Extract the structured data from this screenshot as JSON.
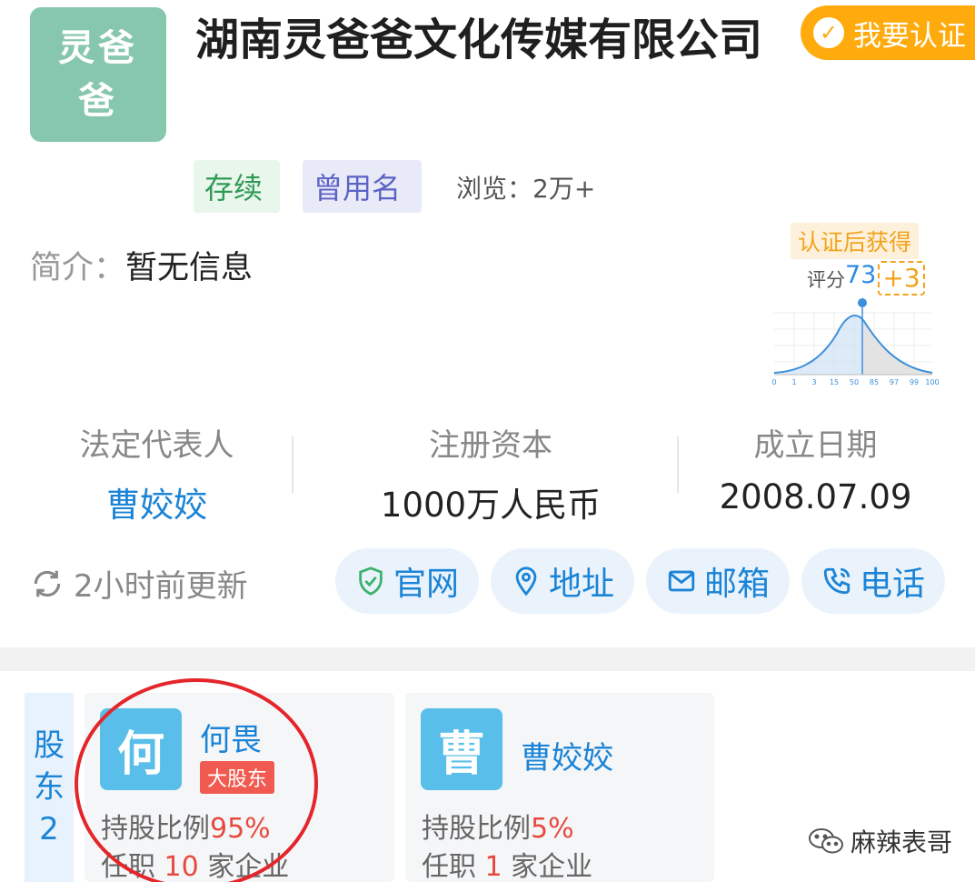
{
  "company": {
    "logo_text_line1": "灵爸",
    "logo_text_line2": "爸",
    "name": "湖南灵爸爸文化传媒有限公司",
    "certify_label": "我要认证",
    "status_tag": "存续",
    "old_name_tag": "曾用名",
    "views": "浏览：2万+",
    "intro_label": "简介：",
    "intro_value": "暂无信息"
  },
  "score": {
    "tip": "认证后获得",
    "label": "评分",
    "value": "73",
    "bonus": "+3",
    "axis_ticks": [
      "0",
      "1",
      "3",
      "15",
      "50",
      "85",
      "97",
      "99",
      "100"
    ]
  },
  "stats": [
    {
      "label": "法定代表人",
      "value": "曹姣姣"
    },
    {
      "label": "注册资本",
      "value": "1000万人民币"
    },
    {
      "label": "成立日期",
      "value": "2008.07.09"
    }
  ],
  "updated": "2小时前更新",
  "actions": [
    {
      "label": "官网",
      "icon": "shield-check-icon"
    },
    {
      "label": "地址",
      "icon": "location-pin-icon"
    },
    {
      "label": "邮箱",
      "icon": "mail-icon"
    },
    {
      "label": "电话",
      "icon": "phone-icon"
    }
  ],
  "shareholders": {
    "tab_line1": "股",
    "tab_line2": "东",
    "tab_count": "2",
    "items": [
      {
        "avatar": "何",
        "name": "何畏",
        "badge": "大股东",
        "ratio_label": "持股比例",
        "ratio": "95%",
        "jobs_prefix": "任职 ",
        "jobs_count": "10",
        "jobs_suffix": " 家企业"
      },
      {
        "avatar": "曹",
        "name": "曹姣姣",
        "ratio_label": "持股比例",
        "ratio": "5%",
        "jobs_prefix": "任职 ",
        "jobs_count": "1",
        "jobs_suffix": " 家企业"
      }
    ]
  },
  "watermark": "麻辣表哥",
  "colors": {
    "accent": "#1b84d6",
    "certify": "#ffab0e",
    "highlight": "#e64a3f",
    "annotation": "#e4262b"
  }
}
